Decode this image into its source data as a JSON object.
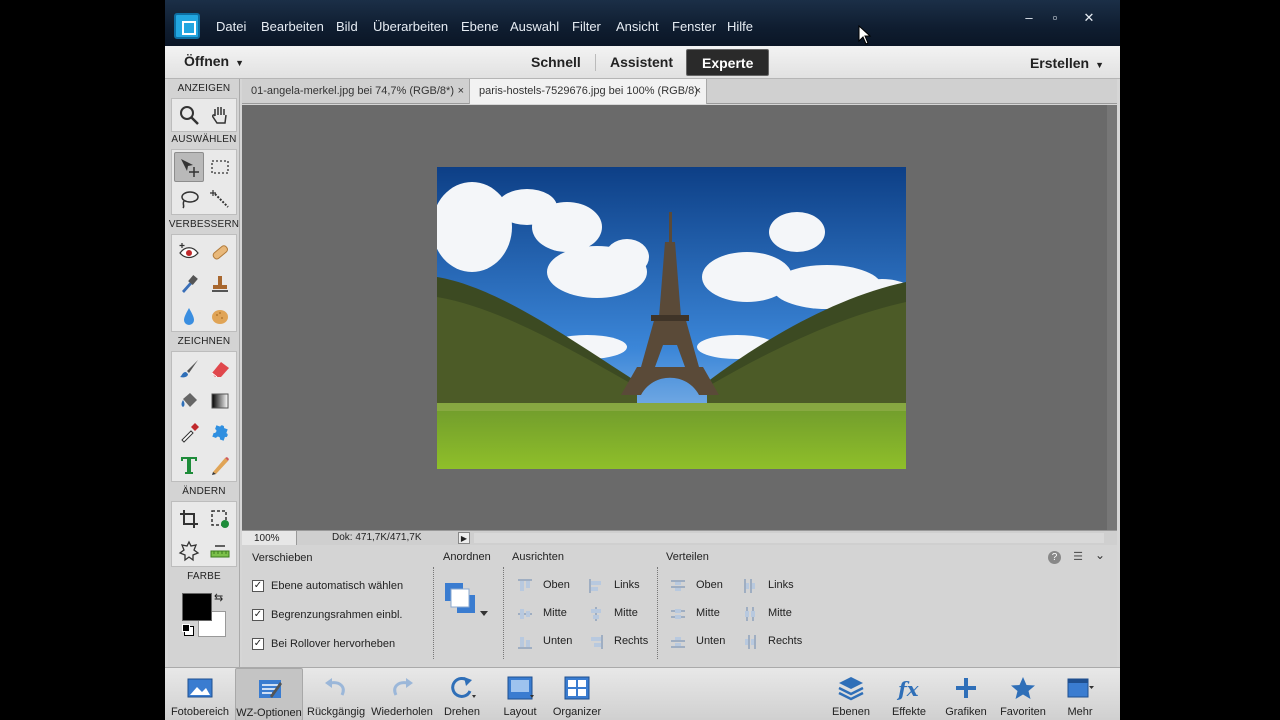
{
  "menubar": {
    "items": [
      "Datei",
      "Bearbeiten",
      "Bild",
      "Überarbeiten",
      "Ebene",
      "Auswahl",
      "Filter",
      "Ansicht",
      "Fenster",
      "Hilfe"
    ],
    "window_controls": [
      "–",
      "▫",
      "✕"
    ]
  },
  "modebar": {
    "open_label": "Öffnen",
    "modes": [
      "Schnell",
      "Assistent",
      "Experte"
    ],
    "active_mode": "Experte",
    "create_label": "Erstellen"
  },
  "doc_tabs": [
    {
      "label": "01-angela-merkel.jpg bei 74,7% (RGB/8*)",
      "close": "×",
      "active": false
    },
    {
      "label": "paris-hostels-7529676.jpg bei 100% (RGB/8)",
      "close": "×",
      "active": true
    }
  ],
  "toolbox": {
    "sections": [
      "ANZEIGEN",
      "AUSWÄHLEN",
      "VERBESSERN",
      "ZEICHNEN",
      "ÄNDERN",
      "FARBE"
    ],
    "foreground_color": "#000000",
    "background_color": "#ffffff"
  },
  "status": {
    "zoom": "100%",
    "doc_size": "Dok: 471,7K/471,7K"
  },
  "options": {
    "tool_name": "Verschieben",
    "checkboxes": [
      {
        "label": "Ebene automatisch wählen",
        "checked": true
      },
      {
        "label": "Begrenzungsrahmen einbl.",
        "checked": true
      },
      {
        "label": "Bei Rollover hervorheben",
        "checked": true
      }
    ],
    "arrange_title": "Anordnen",
    "align_title": "Ausrichten",
    "align_items": [
      "Oben",
      "Mitte",
      "Unten",
      "Links",
      "Mitte",
      "Rechts"
    ],
    "distribute_title": "Verteilen",
    "distribute_items": [
      "Oben",
      "Mitte",
      "Unten",
      "Links",
      "Mitte",
      "Rechts"
    ],
    "help": "?"
  },
  "taskbar": {
    "left": [
      "Fotobereich",
      "WZ-Optionen",
      "Rückgängig",
      "Wiederholen",
      "Drehen",
      "Layout",
      "Organizer"
    ],
    "right": [
      "Ebenen",
      "Effekte",
      "Grafiken",
      "Favoriten",
      "Mehr"
    ]
  },
  "colors": {
    "accent_blue": "#2f6fb8",
    "canvas_bg": "#6a6a6a"
  }
}
